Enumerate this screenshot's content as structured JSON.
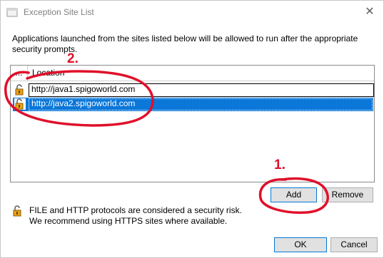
{
  "window": {
    "title": "Exception Site List",
    "close_glyph": "✕"
  },
  "description": "Applications launched from the sites listed below will be allowed to run after the appropriate security prompts.",
  "table": {
    "columns": [
      "...",
      "Location"
    ],
    "rows": [
      {
        "url": "http://java1.spigoworld.com",
        "icon": "lock-icon",
        "selected": false
      },
      {
        "url": "http://java2.spigoworld.com",
        "icon": "lock-icon",
        "selected": true
      }
    ]
  },
  "buttons": {
    "add": "Add",
    "remove": "Remove",
    "ok": "OK",
    "cancel": "Cancel"
  },
  "warning": {
    "line1": "FILE and HTTP protocols are considered a security risk.",
    "line2": "We recommend using HTTPS sites where available."
  },
  "annotations": {
    "label_1": "1.",
    "label_2": "2.",
    "color": "#e0102a"
  },
  "colors": {
    "selection": "#0a77d9",
    "default_button_border": "#0078d7"
  }
}
